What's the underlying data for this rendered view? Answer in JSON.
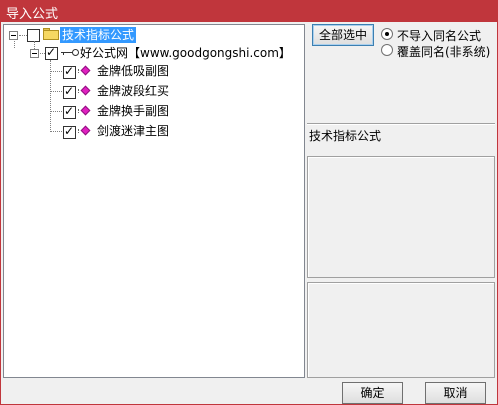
{
  "window": {
    "title": "导入公式"
  },
  "tree": {
    "root": {
      "label": "技术指标公式",
      "checked": false
    },
    "source": {
      "label": "好公式网【www.goodgongshi.com】",
      "checked": true
    },
    "items": [
      {
        "label": "金牌低吸副图",
        "checked": true
      },
      {
        "label": "金牌波段红买",
        "checked": true
      },
      {
        "label": "金牌换手副图",
        "checked": true
      },
      {
        "label": "剑渡迷津主图",
        "checked": true
      }
    ]
  },
  "side": {
    "select_all_label": "全部选中",
    "options": [
      {
        "label": "不导入同名公式",
        "selected": true
      },
      {
        "label": "覆盖同名(非系统)",
        "selected": false
      }
    ],
    "info_title": "技术指标公式"
  },
  "footer": {
    "ok_label": "确定",
    "cancel_label": "取消"
  },
  "colors": {
    "titlebar": "#c0363c",
    "selection": "#3399ff"
  }
}
